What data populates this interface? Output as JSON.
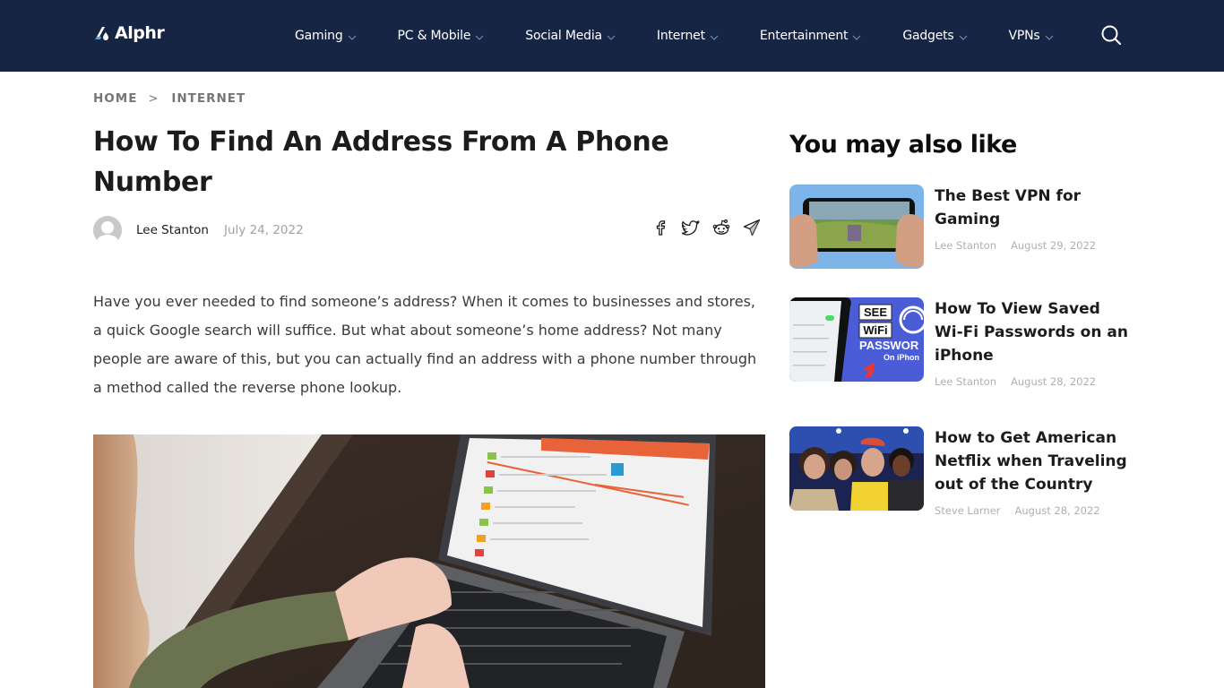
{
  "header": {
    "logo_text": "Alphr",
    "nav": [
      {
        "label": "Gaming",
        "icon": "chevron-down-icon"
      },
      {
        "label": "PC & Mobile",
        "icon": "chevron-down-icon"
      },
      {
        "label": "Social Media",
        "icon": "chevron-down-icon"
      },
      {
        "label": "Internet",
        "icon": "chevron-down-icon"
      },
      {
        "label": "Entertainment",
        "icon": "chevron-down-icon"
      },
      {
        "label": "Gadgets",
        "icon": "chevron-down-icon"
      },
      {
        "label": "VPNs",
        "icon": "chevron-down-icon"
      }
    ],
    "search_icon": "search-icon"
  },
  "breadcrumb": {
    "items": [
      "HOME",
      "INTERNET"
    ],
    "separator": ">"
  },
  "article": {
    "title": "How To Find An Address From A Phone Number",
    "author": "Lee Stanton",
    "date": "July 24, 2022",
    "share_icons": [
      "facebook-icon",
      "twitter-icon",
      "reddit-icon",
      "telegram-icon"
    ],
    "intro": "Have you ever needed to find someone’s address? When it comes to businesses and stores, a quick Google search will suffice. But what about someone’s home address? Not many people are aware of this, but you can actually find an address with a phone number through a method called the reverse phone lookup.",
    "hero_image": "woman typing on laptop showing reverse phone lookup website"
  },
  "sidebar": {
    "heading": "You may also like",
    "cards": [
      {
        "title": "The Best VPN for Gaming",
        "author": "Lee Stanton",
        "date": "August 29, 2022",
        "thumb": "hands holding phone playing mobile game"
      },
      {
        "title": "How To View Saved Wi-Fi Passwords on an iPhone",
        "author": "Lee Stanton",
        "date": "August 28, 2022",
        "thumb": "SEE WiFi PASSWORD On iPhone"
      },
      {
        "title": "How to Get American Netflix when Traveling out of the Country",
        "author": "Steve Larner",
        "date": "August 28, 2022",
        "thumb": "Stranger Things cast"
      }
    ]
  },
  "colors": {
    "header_bg": "#172544",
    "accent": "#4a7fc4",
    "logo_accent": "#3fa9f5"
  }
}
